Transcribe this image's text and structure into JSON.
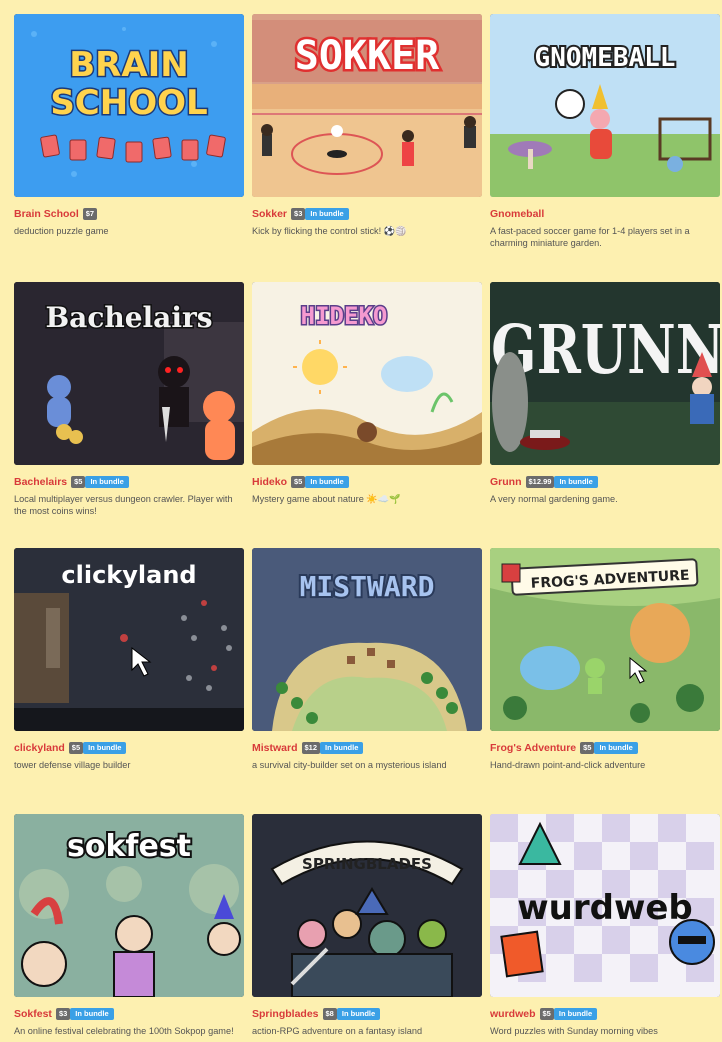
{
  "games": [
    {
      "title": "Brain School",
      "price": "$7",
      "bundle": "",
      "desc": "deduction puzzle game",
      "art": "BRAIN SCHOOL"
    },
    {
      "title": "Sokker",
      "price": "$3",
      "bundle": "In bundle",
      "desc": "Kick by flicking the control stick! ⚽🏐",
      "art": "SOKKER"
    },
    {
      "title": "Gnomeball",
      "price": "",
      "bundle": "",
      "desc": "A fast-paced soccer game for 1-4 players set in a charming miniature garden.",
      "art": "GNOMEBALL"
    },
    {
      "title": "Bachelairs",
      "price": "$5",
      "bundle": "In bundle",
      "desc": "Local multiplayer versus dungeon crawler. Player with the most coins wins!",
      "art": "Bachelairs"
    },
    {
      "title": "Hideko",
      "price": "$5",
      "bundle": "In bundle",
      "desc": "Mystery game about nature ☀️☁️🌱",
      "art": "HIDEKO"
    },
    {
      "title": "Grunn",
      "price": "$12.99",
      "bundle": "In bundle",
      "desc": "A very normal gardening game.",
      "art": "GRUNN"
    },
    {
      "title": "clickyland",
      "price": "$5",
      "bundle": "In bundle",
      "desc": "tower defense village builder",
      "art": "clickyland"
    },
    {
      "title": "Mistward",
      "price": "$12",
      "bundle": "In bundle",
      "desc": "a survival city-builder set on a mysterious island",
      "art": "MISTWARD"
    },
    {
      "title": "Frog's Adventure",
      "price": "$5",
      "bundle": "In bundle",
      "desc": "Hand-drawn point-and-click adventure",
      "art": "FROG'S ADVENTURE"
    },
    {
      "title": "Sokfest",
      "price": "$3",
      "bundle": "In bundle",
      "desc": "An online festival celebrating the 100th Sokpop game!",
      "art": "sokfest"
    },
    {
      "title": "Springblades",
      "price": "$8",
      "bundle": "In bundle",
      "desc": "action-RPG adventure on a fantasy island",
      "art": "SPRINGBLADES"
    },
    {
      "title": "wurdweb",
      "price": "$5",
      "bundle": "In bundle",
      "desc": "Word puzzles with Sunday morning vibes",
      "art": "wurdweb"
    }
  ]
}
